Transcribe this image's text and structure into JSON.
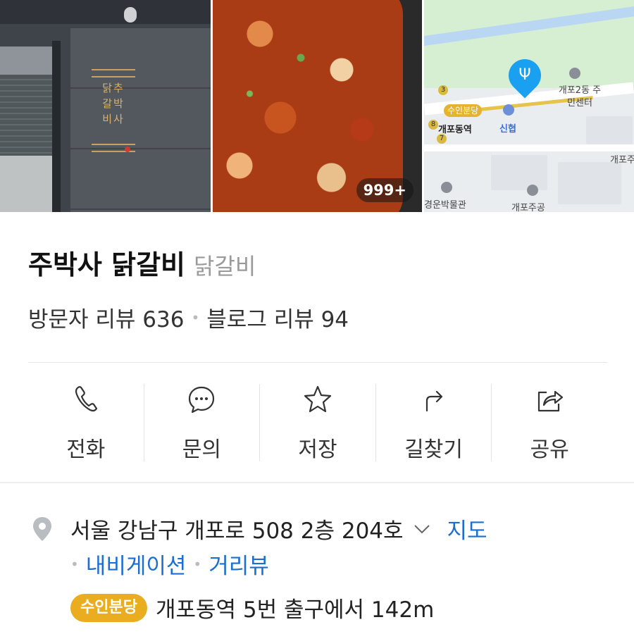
{
  "photos": {
    "sign_text": "닭추 갈박 비사",
    "photo_count": "999+",
    "map": {
      "station_tag": "수인분당",
      "station_name": "개포동역",
      "bank": "신협",
      "community_center": "개포2동 주민센터",
      "museum": "경운박물관",
      "apartment": "개포주공",
      "edge_label": "개포주",
      "circle_3": "3",
      "circle_8": "8",
      "circle_7": "7"
    }
  },
  "place": {
    "name": "주박사 닭갈비",
    "category": "닭갈비",
    "visitor_reviews": "방문자 리뷰 636",
    "blog_reviews": "블로그 리뷰 94"
  },
  "actions": [
    {
      "label": "전화",
      "icon": "phone-icon"
    },
    {
      "label": "문의",
      "icon": "chat-icon"
    },
    {
      "label": "저장",
      "icon": "star-icon"
    },
    {
      "label": "길찾기",
      "icon": "directions-icon"
    },
    {
      "label": "공유",
      "icon": "share-icon"
    }
  ],
  "address": {
    "text": "서울 강남구 개포로 508 2층 204호",
    "map_link": "지도",
    "navigation_link": "내비게이션",
    "streetview_link": "거리뷰",
    "subway_line": "수인분당",
    "station_distance": "개포동역 5번 출구에서 142m"
  },
  "colors": {
    "link": "#1a6fd1",
    "subway_badge": "#e9ad1f",
    "map_pin": "#1aa0f0"
  }
}
